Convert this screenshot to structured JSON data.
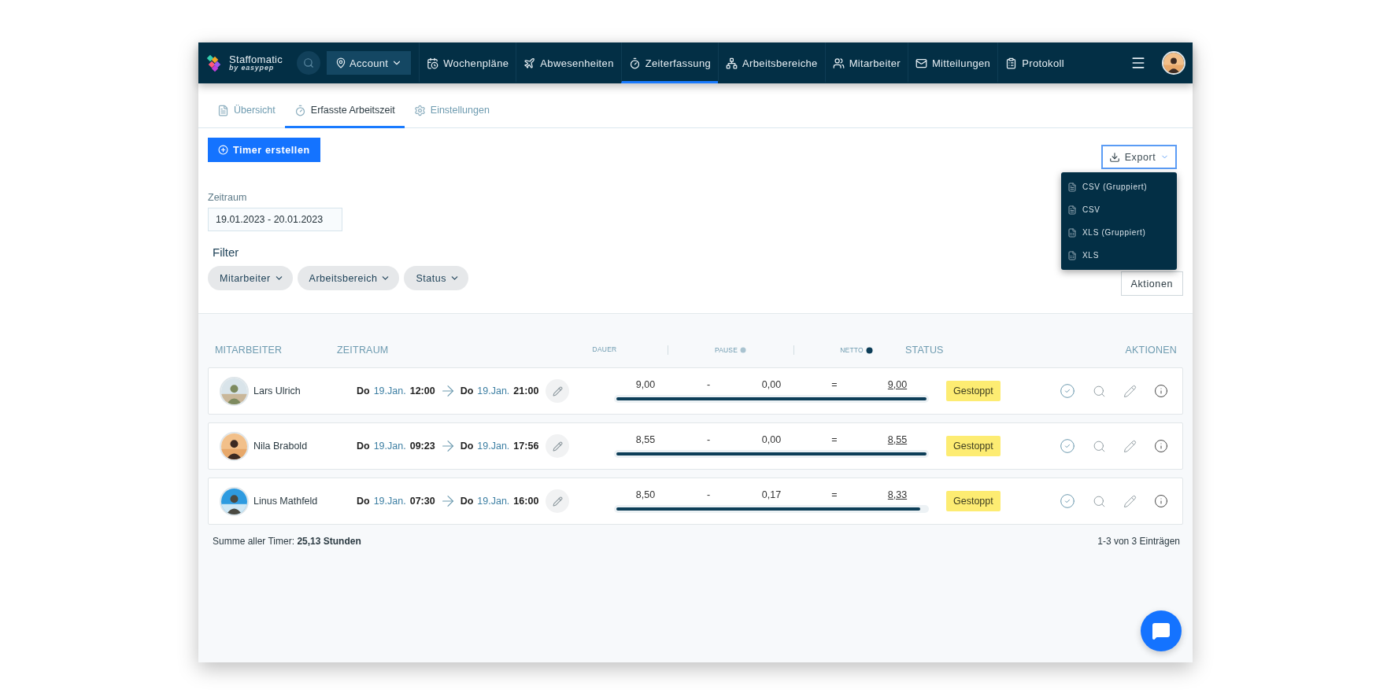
{
  "nav": {
    "logo": {
      "name": "Staffomatic",
      "tagline": "by easypep"
    },
    "account": {
      "label": "Account"
    },
    "items": [
      {
        "label": "Wochenpläne",
        "selected": false
      },
      {
        "label": "Abwesenheiten",
        "selected": false
      },
      {
        "label": "Zeiterfassung",
        "selected": true
      },
      {
        "label": "Arbeitsbereiche",
        "selected": false
      },
      {
        "label": "Mitarbeiter",
        "selected": false
      },
      {
        "label": "Mitteilungen",
        "selected": false
      },
      {
        "label": "Protokoll",
        "selected": false
      }
    ]
  },
  "subtabs": [
    {
      "label": "Übersicht",
      "selected": false
    },
    {
      "label": "Erfasste Arbeitszeit",
      "selected": true
    },
    {
      "label": "Einstellungen",
      "selected": false
    }
  ],
  "create_button": "Timer erstellen",
  "export": {
    "label": "Export",
    "expanded": true,
    "options": [
      "CSV (Gruppiert)",
      "CSV",
      "XLS (Gruppiert)",
      "XLS"
    ]
  },
  "period": {
    "label": "Zeitraum",
    "value": "19.01.2023 - 20.01.2023"
  },
  "filter": {
    "title": "Filter",
    "chips": [
      "Mitarbeiter",
      "Arbeitsbereich",
      "Status"
    ]
  },
  "actions_button": "Aktionen",
  "table": {
    "columns": [
      {
        "label": "MITARBEITER",
        "kind": "main"
      },
      {
        "label": "ZEITRAUM",
        "kind": "main"
      },
      {
        "label": "DAUER",
        "kind": "sub"
      },
      {
        "label": "PAUSE",
        "kind": "sub"
      },
      {
        "label": "NETTO",
        "kind": "sub"
      },
      {
        "label": "STATUS",
        "kind": "main"
      },
      {
        "label": "AKTIONEN",
        "kind": "main"
      }
    ],
    "rows": [
      {
        "name": "Lars Ulrich",
        "start_day": "Do",
        "start_date": "19.Jan.",
        "start_time": "12:00",
        "end_day": "Do",
        "end_date": "19.Jan.",
        "end_time": "21:00",
        "dauer": "9,00",
        "minus": "-",
        "pause": "0,00",
        "equals": "=",
        "netto": "9,00",
        "level": 1,
        "status": "Gestoppt"
      },
      {
        "name": "Nila Brabold",
        "start_day": "Do",
        "start_date": "19.Jan.",
        "start_time": "09:23",
        "end_day": "Do",
        "end_date": "19.Jan.",
        "end_time": "17:56",
        "dauer": "8,55",
        "minus": "-",
        "pause": "0,00",
        "equals": "=",
        "netto": "8,55",
        "level": 1,
        "status": "Gestoppt"
      },
      {
        "name": "Linus Mathfeld",
        "start_day": "Do",
        "start_date": "19.Jan.",
        "start_time": "07:30",
        "end_day": "Do",
        "end_date": "19.Jan.",
        "end_time": "16:00",
        "dauer": "8,50",
        "minus": "-",
        "pause": "0,17",
        "equals": "=",
        "netto": "8,33",
        "level": 0.98,
        "status": "Gestoppt"
      }
    ]
  },
  "summary": {
    "label": "Summe aller Timer:",
    "value": "25,13 Stunden"
  },
  "pagination": "1-3 von 3 Einträgen"
}
